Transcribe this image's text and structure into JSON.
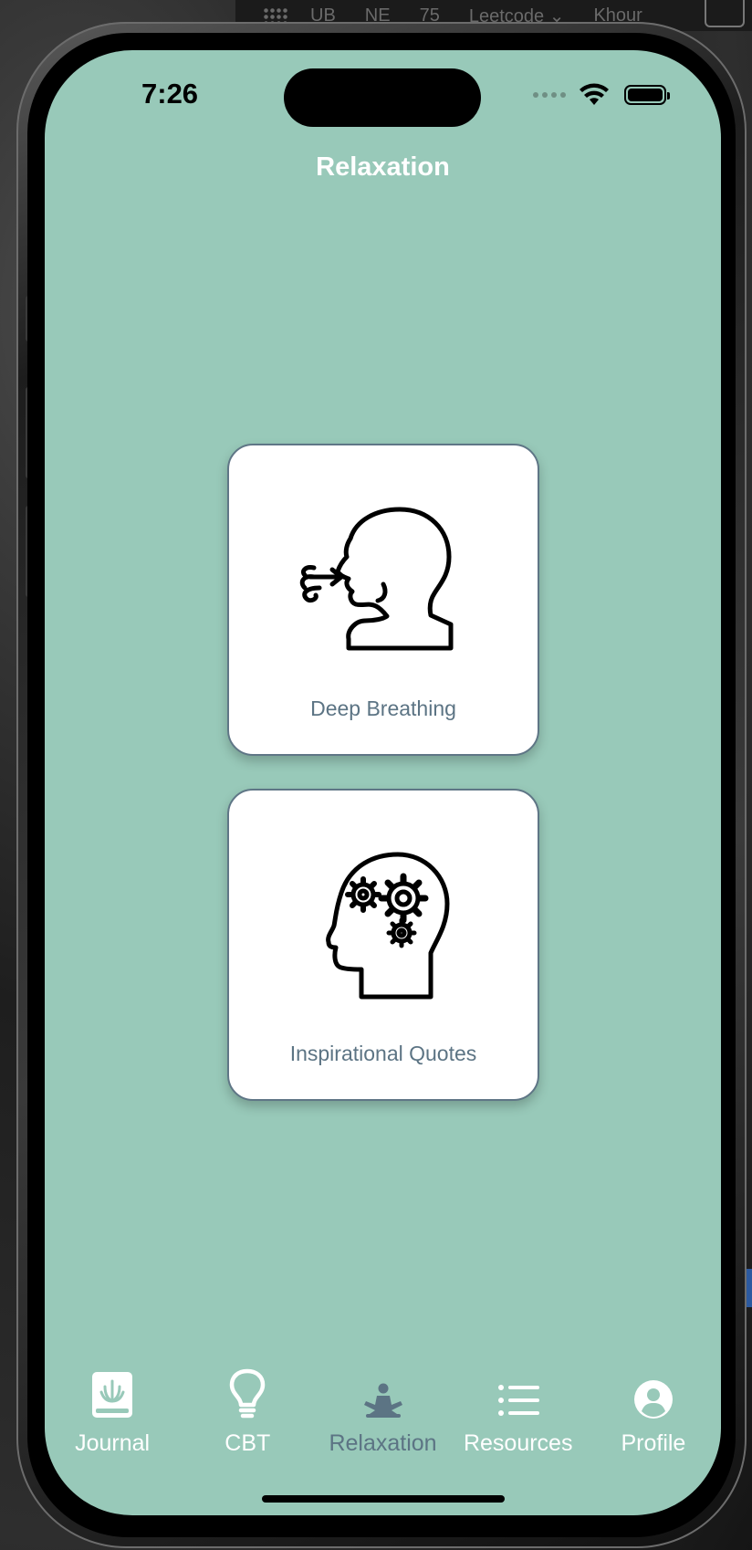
{
  "desktop_bar": {
    "items": [
      "UB",
      "NE",
      "75",
      "Leetcode ⌄",
      "Khour"
    ]
  },
  "status_bar": {
    "time": "7:26"
  },
  "header": {
    "title": "Relaxation"
  },
  "cards": [
    {
      "label": "Deep Breathing",
      "icon": "breathing-head-icon"
    },
    {
      "label": "Inspirational Quotes",
      "icon": "head-gears-icon"
    }
  ],
  "tabbar": {
    "tabs": [
      {
        "label": "Journal",
        "icon": "journal-book-icon",
        "active": false
      },
      {
        "label": "CBT",
        "icon": "lightbulb-icon",
        "active": false
      },
      {
        "label": "Relaxation",
        "icon": "meditation-icon",
        "active": true
      },
      {
        "label": "Resources",
        "icon": "list-icon",
        "active": false
      },
      {
        "label": "Profile",
        "icon": "profile-icon",
        "active": false
      }
    ]
  },
  "colors": {
    "screen_bg": "#98c9b9",
    "card_bg": "#ffffff",
    "card_border": "#5f7686",
    "active_tab": "#5c7484",
    "inactive_tab": "#ffffff"
  }
}
